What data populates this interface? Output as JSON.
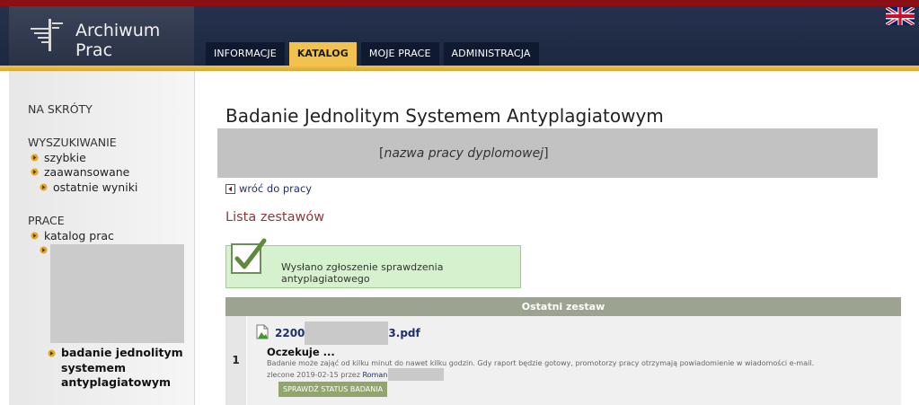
{
  "app": {
    "title": "Archiwum Prac"
  },
  "nav": {
    "tabs": [
      {
        "label": "INFORMACJE",
        "active": false
      },
      {
        "label": "KATALOG",
        "active": true
      },
      {
        "label": "MOJE PRACE",
        "active": false
      },
      {
        "label": "ADMINISTRACJA",
        "active": false
      }
    ]
  },
  "language_flag": "uk-flag-icon",
  "sidebar": {
    "shortcuts": "NA SKRÓTY",
    "search": {
      "heading": "WYSZUKIWANIE",
      "items": [
        "szybkie",
        "zaawansowane",
        "ostatnie wyniki"
      ]
    },
    "works": {
      "heading": "PRACE",
      "items": [
        "katalog prac"
      ]
    },
    "current_lines": [
      "badanie jednolitym",
      "systemem",
      "antyplagiatowym"
    ]
  },
  "main": {
    "title": "Badanie Jednolitym Systemem Antyplagiatowym",
    "thesis_placeholder": {
      "open": "[",
      "text": "nazwa pracy dyplomowej",
      "close": "]"
    },
    "back_link": "wróć do pracy",
    "list_heading": "Lista zestawów",
    "message": "Wysłano zgłoszenie sprawdzenia antyplagiatowego",
    "table": {
      "header": "Ostatni zestaw",
      "rows": [
        {
          "number": "1",
          "file_prefix": "2200",
          "file_suffix": "3.pdf",
          "status": "Oczekuje ...",
          "description": "Badanie może zająć od kilku minut do nawet kilku godzin. Gdy raport będzie gotowy, promotorzy pracy otrzymają powiadomienie w wiadomości e-mail.",
          "ordered_prefix": "zlecone 2019-02-15 przez",
          "ordered_user": "Roman",
          "button": "SPRAWDŹ STATUS BADANIA"
        }
      ]
    }
  },
  "colors": {
    "top_accent": "#8b0f14",
    "header_bg": "#1c2740",
    "tab_active": "#f2c24e",
    "gold_bar": "#d8a632",
    "success_bg": "#d6f1ce",
    "table_header": "#9ca391",
    "button_bg": "#93a56f",
    "link": "#1f2f6d",
    "section_heading": "#8b3a3a"
  }
}
